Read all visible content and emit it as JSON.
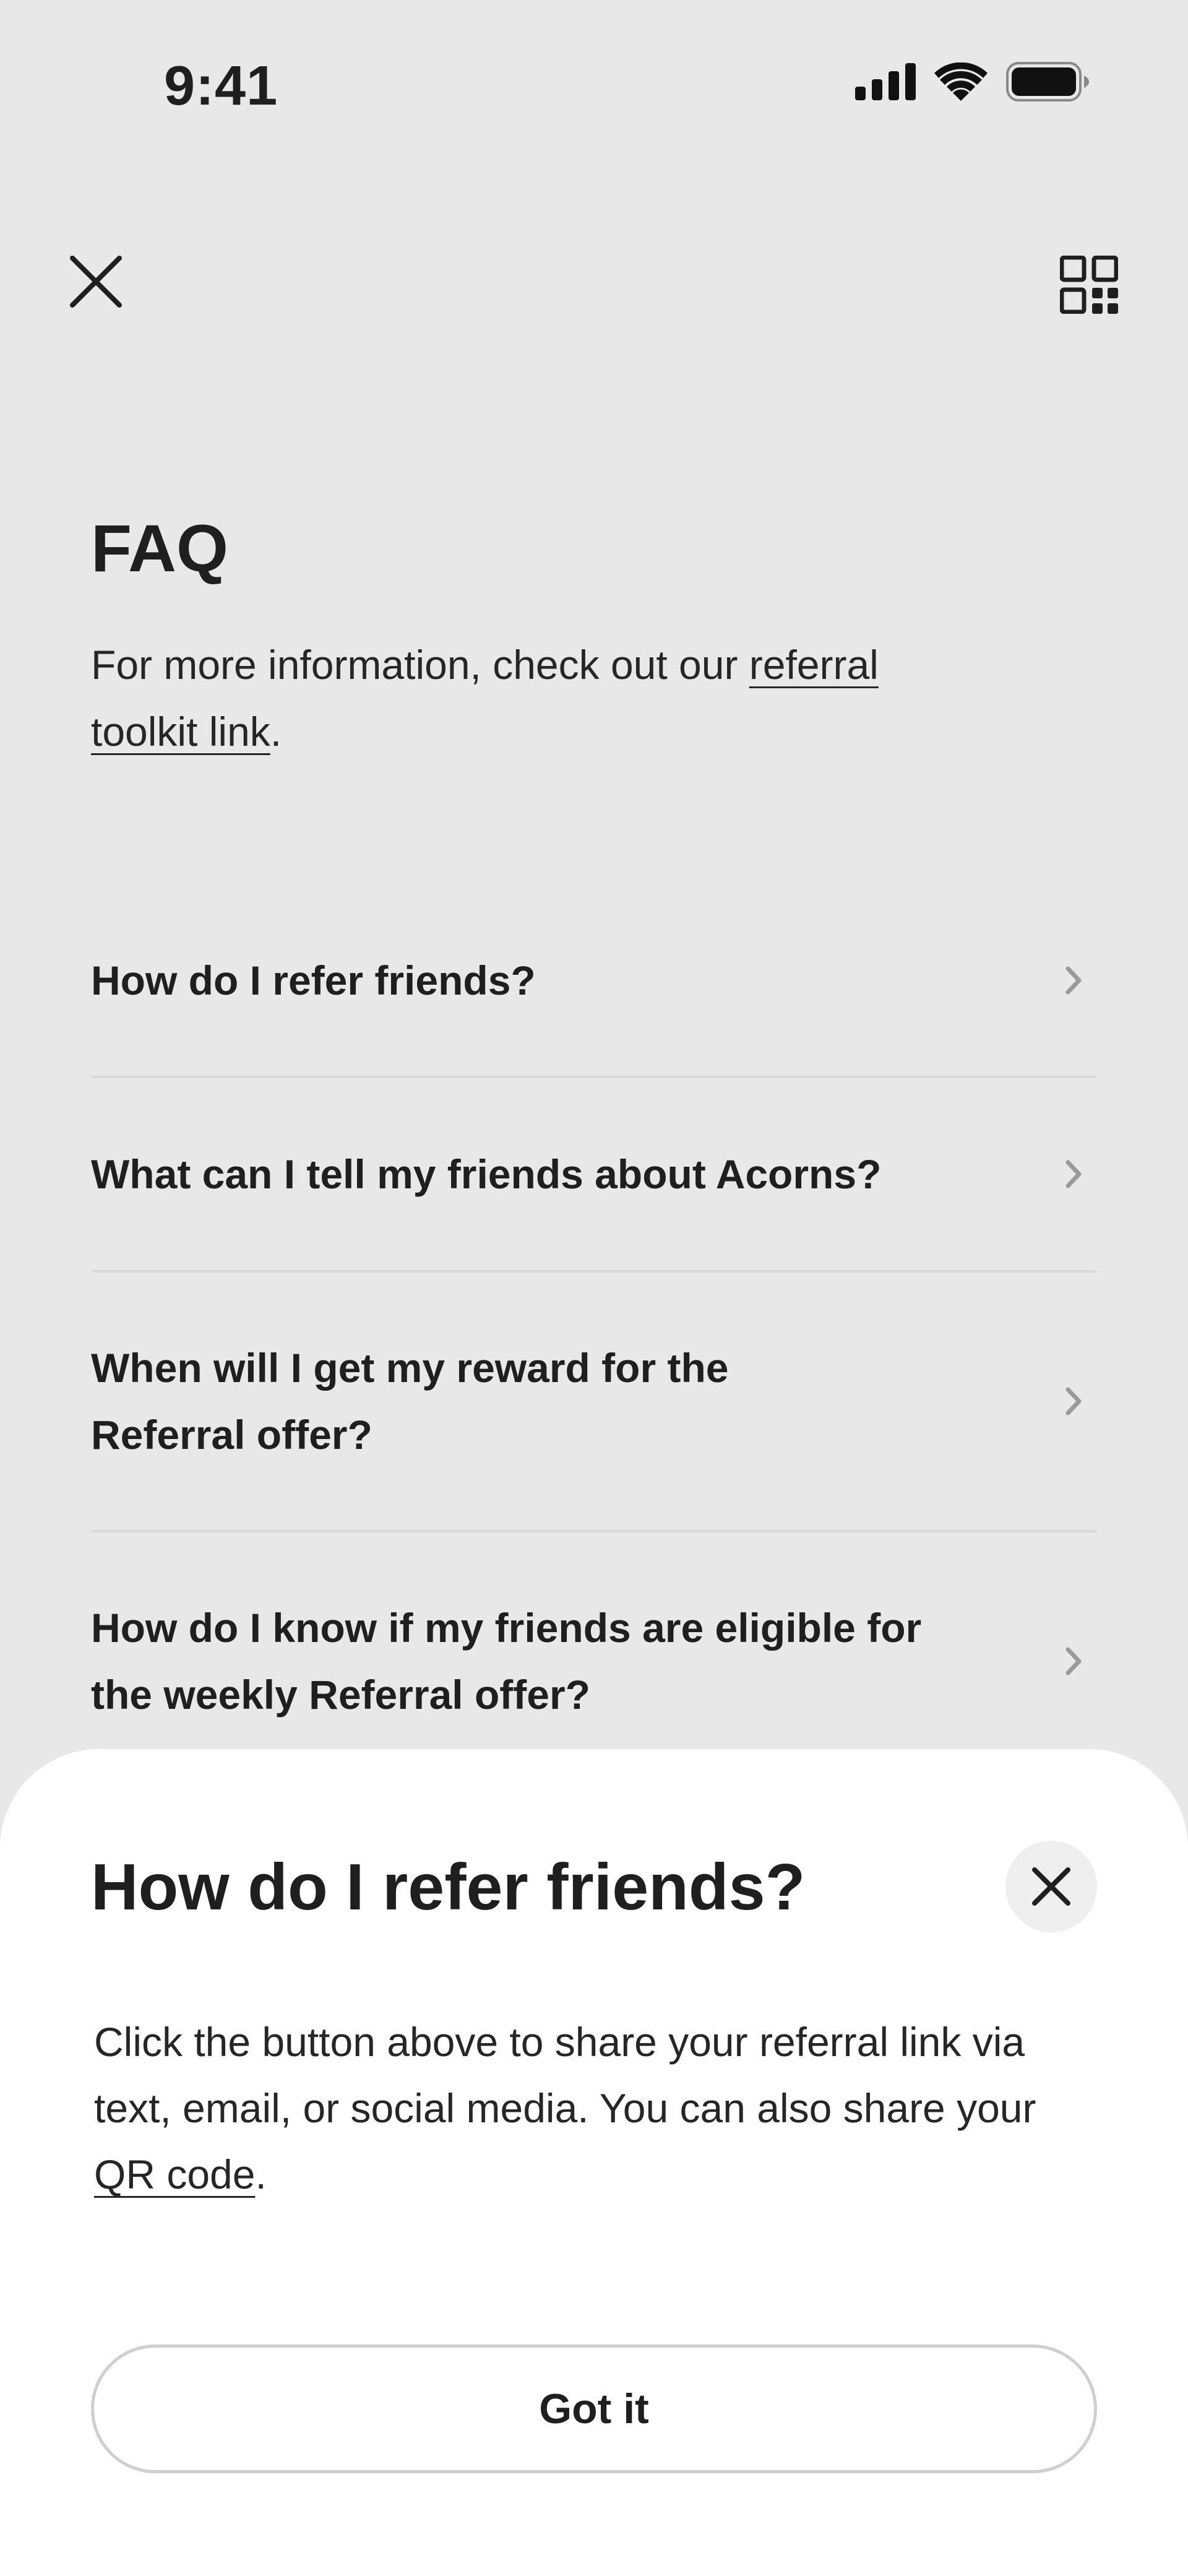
{
  "status_bar": {
    "time": "9:41",
    "icons": [
      "cellular-signal-icon",
      "wifi-icon",
      "battery-icon"
    ]
  },
  "top_bar": {
    "close_icon": "close-icon",
    "qr_icon": "qr-code-icon"
  },
  "faq": {
    "title": "FAQ",
    "intro_prefix": "For more information, check out our ",
    "intro_link": "referral toolkit link",
    "intro_suffix": ".",
    "items": [
      {
        "question": "How do I refer friends?"
      },
      {
        "question": "What can I tell my friends about Acorns?"
      },
      {
        "question": "When will I get my reward for the Referral offer?"
      },
      {
        "question": "How do I know if my friends are eligible for the weekly Referral offer?"
      }
    ]
  },
  "sheet": {
    "title": "How do I refer friends?",
    "body_prefix": "Click the button above to share your referral link via text, email, or social media. You can also share your ",
    "body_link": "QR code",
    "body_suffix": ".",
    "button_label": "Got it"
  },
  "colors": {
    "background": "#e8e8e8",
    "sheet": "#ffffff",
    "text": "#1f1f1f",
    "divider": "#d9d9d9"
  }
}
